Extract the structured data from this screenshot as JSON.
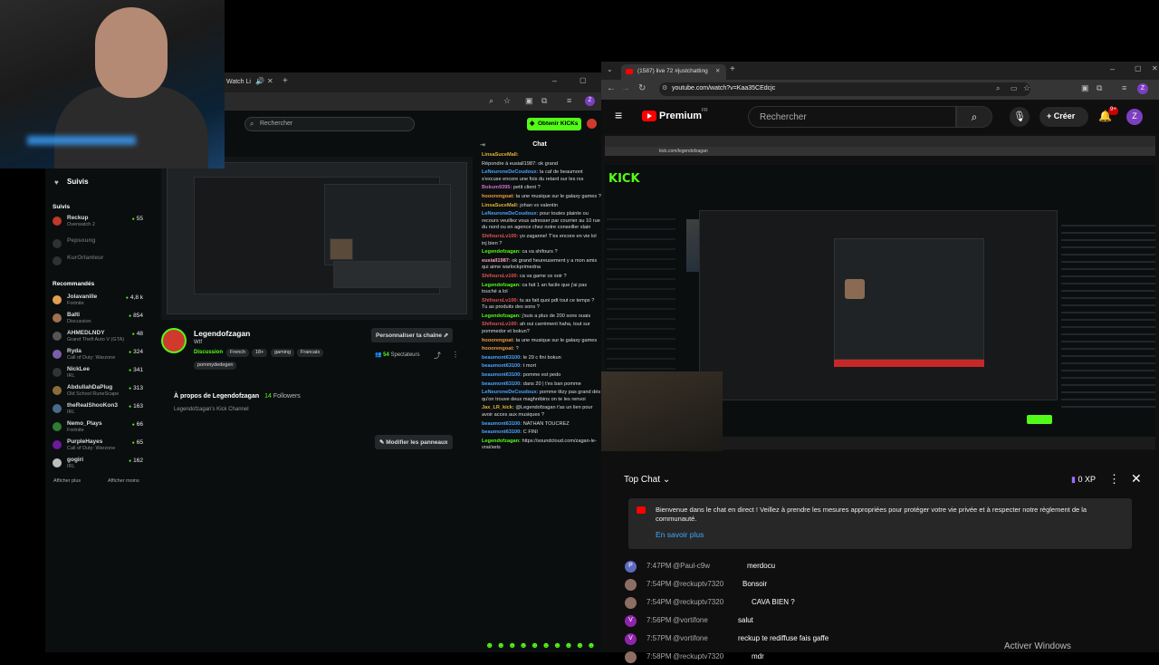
{
  "kick": {
    "tab_title": "Watch Li",
    "search_placeholder": "Rechercher",
    "obtain_kicks": "Obtenir KICKs",
    "following_label": "Suivis",
    "followed_header": "Suivis",
    "followed": [
      {
        "name": "Reckup",
        "game": "Overwatch 2",
        "viewers": "55"
      },
      {
        "name": "Pepsoung",
        "game": "",
        "viewers": ""
      },
      {
        "name": "KurOrlanteur",
        "game": "",
        "viewers": ""
      }
    ],
    "recommended_header": "Recommandés",
    "recommended": [
      {
        "name": "Jolavanille",
        "game": "Fortnite",
        "viewers": "4,8 k"
      },
      {
        "name": "Balti",
        "game": "Discussion",
        "viewers": "854"
      },
      {
        "name": "AHMEDLNDY",
        "game": "Grand Theft Auto V (GTA)",
        "viewers": "48"
      },
      {
        "name": "Ryda",
        "game": "Call of Duty: Warzone",
        "viewers": "324"
      },
      {
        "name": "NickLee",
        "game": "IRL",
        "viewers": "341"
      },
      {
        "name": "AbdullahDaPlug",
        "game": "Old School RuneScape",
        "viewers": "313"
      },
      {
        "name": "theRealShooKon3",
        "game": "IRL",
        "viewers": "163"
      },
      {
        "name": "Nemo_Plays",
        "game": "Fortnite",
        "viewers": "66"
      },
      {
        "name": "PurpleHayes",
        "game": "Call of Duty: Warzone",
        "viewers": "65"
      },
      {
        "name": "gogiri",
        "game": "IRL",
        "viewers": "162"
      }
    ],
    "show_more": "Afficher plus",
    "show_less": "Afficher moins",
    "channel": {
      "name": "Legendofzagan",
      "subtitle": "Wtf",
      "category": "Discussion",
      "tags": [
        "French",
        "18+",
        "gaming",
        "Francais",
        "pommydedegen"
      ],
      "customize_button": "Personnaliser ta chaîne",
      "viewers": "54",
      "viewers_label": "Spectateurs",
      "about_prefix": "À propos de",
      "about_name": "Legendofzagan",
      "followers": "14",
      "followers_label": "Followers",
      "about_sub": "Legendofzagan's Kick Channel",
      "edit_panels_button": "Modifier les panneaux"
    },
    "chat": {
      "title": "Chat",
      "messages": [
        {
          "user": "LinsaSuceMall:",
          "color": "#e0b23a",
          "text": ""
        },
        {
          "user": "",
          "color": "#888",
          "text": "Répondre à eusiall1987: ok grand"
        },
        {
          "user": "LeNeuroneDeCoudoux:",
          "color": "#4aa3ff",
          "text": "la caf de beaumont s'excuse encore une fois du retard sur les rss"
        },
        {
          "user": "Bokum9395:",
          "color": "#d06bd0",
          "text": "petit client ?"
        },
        {
          "user": "hooorengoat:",
          "color": "#f09a3a",
          "text": "ta une musique sur le galaxy games ?"
        },
        {
          "user": "LinsaSuceMall:",
          "color": "#e0b23a",
          "text": "johan vs valentin"
        },
        {
          "user": "LeNeuroneDeCoudoux:",
          "color": "#4aa3ff",
          "text": "pour toutes plainte ou recours veuillez vous adresser par courrier au 10 rue du nord ou en agence chez notre conseiller slain"
        },
        {
          "user": "ShifoursLv100:",
          "color": "#e05050",
          "text": "yo zaganne! T'es encore en vie lol inj bien ?"
        },
        {
          "user": "Legendofzagan:",
          "color": "#53fc18",
          "text": "ca va shifours ?"
        },
        {
          "user": "eusiall1987:",
          "color": "#f0a0c0",
          "text": "ok grand heureusement y a mon amis qui aime warlockprimedna"
        },
        {
          "user": "ShifoursLv100:",
          "color": "#e05050",
          "text": "ca va game ce soir ?"
        },
        {
          "user": "Legendofzagan:",
          "color": "#53fc18",
          "text": "ca fait 1 an facile que j'ai pas touché a lol"
        },
        {
          "user": "ShifoursLv100:",
          "color": "#e05050",
          "text": "tu as fait quoi pdt tout ce temps ? Tu as produits des sons ?"
        },
        {
          "user": "Legendofzagan:",
          "color": "#53fc18",
          "text": "j'suis a plus de 200 sons ouais"
        },
        {
          "user": "ShifoursLv100:",
          "color": "#e05050",
          "text": "ah oui carrément haha, tout sur pommedor et bokun?"
        },
        {
          "user": "hooorengoat:",
          "color": "#f09a3a",
          "text": "ta une musique sur le galaxy games"
        },
        {
          "user": "hooorengoat:",
          "color": "#f09a3a",
          "text": "?"
        },
        {
          "user": "beaumont63100:",
          "color": "#4aa3ff",
          "text": "le 29 c fini bokun"
        },
        {
          "user": "beaumont63100:",
          "color": "#4aa3ff",
          "text": "t mort"
        },
        {
          "user": "beaumont63100:",
          "color": "#4aa3ff",
          "text": "pomme est pedo"
        },
        {
          "user": "beaumont63100:",
          "color": "#4aa3ff",
          "text": "dans 20 | t'es ban pomme"
        },
        {
          "user": "LeNeuroneDeCoudoux:",
          "color": "#4aa3ff",
          "text": "pomme titzy pas grand dés qu'on trouve deux maghrébins on te les renvoi"
        },
        {
          "user": "Jax_LR_kick:",
          "color": "#e0b23a",
          "text": "@Legendofzagan t'as un lien pour avoir acces aux musiques ?"
        },
        {
          "user": "beaumont63100:",
          "color": "#4aa3ff",
          "text": "NATHAN TOUCREZ"
        },
        {
          "user": "beaumont63100:",
          "color": "#4aa3ff",
          "text": "C FINI"
        },
        {
          "user": "Legendofzagan:",
          "color": "#53fc18",
          "text": "https://soundcloud.com/zagan-le-vrai/sets"
        }
      ]
    }
  },
  "youtube": {
    "tab_title": "(1587) live 72 #justchatting",
    "url": "youtube.com/watch?v=Kaa35CEdcjc",
    "brand": "Premium",
    "brand_region": "FR",
    "search_placeholder": "Rechercher",
    "create_button": "Créer",
    "notif_count": "9+",
    "avatar_letter": "Z",
    "inner_url": "kick.com/legendofzagan",
    "chat": {
      "title": "Top Chat",
      "xp": "0 XP",
      "banner_text": "Bienvenue dans le chat en direct ! Veillez à prendre les mesures appropriées pour protéger votre vie privée et à respecter notre règlement de la communauté.",
      "learn_more": "En savoir plus",
      "messages": [
        {
          "time": "7:47PM",
          "author": "@Paul-c9w",
          "text": "merdocu",
          "avatar": "P",
          "color": "#5c6bc0"
        },
        {
          "time": "7:54PM",
          "author": "@reckuptv7320",
          "text": "Bonsoir",
          "avatar": "",
          "color": "#8d6e63"
        },
        {
          "time": "7:54PM",
          "author": "@reckuptv7320",
          "text": "CAVA BIEN ?",
          "avatar": "",
          "color": "#8d6e63"
        },
        {
          "time": "7:56PM",
          "author": "@vortifone",
          "text": "salut",
          "avatar": "V",
          "color": "#8e24aa"
        },
        {
          "time": "7:57PM",
          "author": "@vortifone",
          "text": "reckup te rediffuse fais gaffe",
          "avatar": "V",
          "color": "#8e24aa"
        },
        {
          "time": "7:58PM",
          "author": "@reckuptv7320",
          "text": "mdr",
          "avatar": "",
          "color": "#8d6e63"
        }
      ]
    }
  },
  "system": {
    "activate_windows": "Activer Windows"
  }
}
